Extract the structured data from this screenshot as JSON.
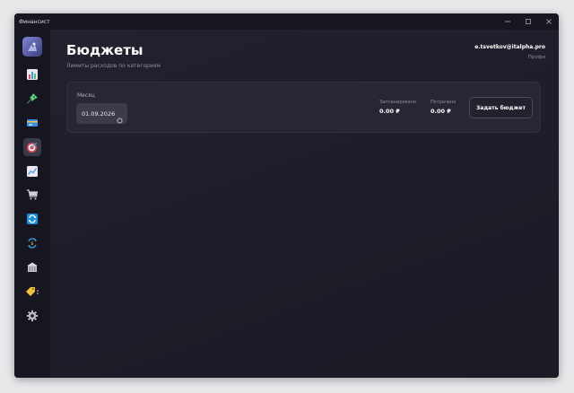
{
  "window": {
    "title": "Финансист",
    "controls": [
      "minimize-icon",
      "maximize-icon",
      "close-icon"
    ]
  },
  "sidebar": {
    "avatar_icon": "user-avatar-icon",
    "items": [
      {
        "name": "bar-chart-icon",
        "active": false
      },
      {
        "name": "pin-icon",
        "active": false
      },
      {
        "name": "credit-card-icon",
        "active": false
      },
      {
        "name": "target-icon",
        "active": true
      },
      {
        "name": "trending-chart-icon",
        "active": false
      },
      {
        "name": "shopping-cart-icon",
        "active": false
      },
      {
        "name": "repeat-icon",
        "active": false
      },
      {
        "name": "exchange-icon",
        "active": false
      },
      {
        "name": "bank-icon",
        "active": false
      },
      {
        "name": "tag-icon",
        "active": false
      },
      {
        "name": "gear-icon",
        "active": false
      }
    ]
  },
  "header": {
    "title": "Бюджеты",
    "subtitle": "Лимиты расходов по категориям",
    "user_email": "e.tsvetkov@italpha.pro",
    "user_plan": "Профи"
  },
  "budget_card": {
    "month_label": "Месяц",
    "month_value": "01.09.2026",
    "planned_label": "Запланировано",
    "planned_value": "0.00 ₽",
    "spent_label": "Потрачено",
    "spent_value": "0.00 ₽",
    "set_budget_label": "Задать бюджет"
  },
  "colors": {
    "background": "#1e1e2a",
    "sidebar": "#161621",
    "card": "#262634",
    "active_nav": "#3a3a48",
    "text_primary": "#ffffff",
    "text_secondary": "#8d8d9b"
  }
}
